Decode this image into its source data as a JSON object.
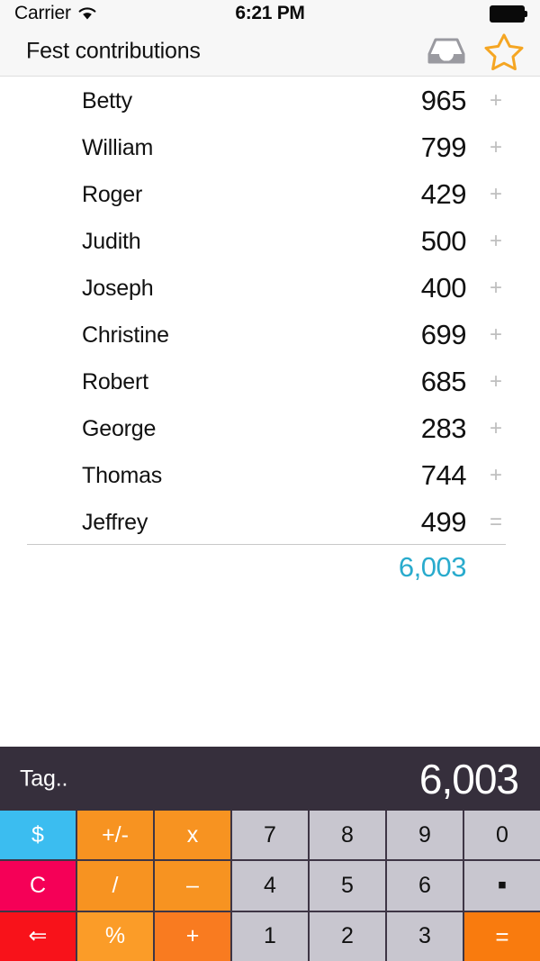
{
  "status_bar": {
    "carrier": "Carrier",
    "wifi_icon": "wifi-icon",
    "time": "6:21 PM",
    "battery_icon": "battery-full-icon"
  },
  "navbar": {
    "title": "Fest contributions",
    "actions": [
      {
        "name": "inbox-icon",
        "label": "Inbox"
      },
      {
        "name": "star-icon",
        "label": "Favorite"
      }
    ]
  },
  "list": {
    "rows": [
      {
        "name": "Betty",
        "value": "965",
        "op": "+"
      },
      {
        "name": "William",
        "value": "799",
        "op": "+"
      },
      {
        "name": "Roger",
        "value": "429",
        "op": "+"
      },
      {
        "name": "Judith",
        "value": "500",
        "op": "+"
      },
      {
        "name": "Joseph",
        "value": "400",
        "op": "+"
      },
      {
        "name": "Christine",
        "value": "699",
        "op": "+"
      },
      {
        "name": "Robert",
        "value": "685",
        "op": "+"
      },
      {
        "name": "George",
        "value": "283",
        "op": "+"
      },
      {
        "name": "Thomas",
        "value": "744",
        "op": "+"
      },
      {
        "name": "Jeffrey",
        "value": "499",
        "op": "="
      }
    ],
    "total": "6,003"
  },
  "calculator": {
    "tag_placeholder": "Tag..",
    "display_value": "6,003",
    "keys": [
      [
        {
          "label": "$",
          "name": "currency-key",
          "style": "act-dollar"
        },
        {
          "label": "+/-",
          "name": "sign-key",
          "style": "op"
        },
        {
          "label": "x",
          "name": "multiply-key",
          "style": "op"
        },
        {
          "label": "7",
          "name": "digit-7-key",
          "style": "num"
        },
        {
          "label": "8",
          "name": "digit-8-key",
          "style": "num"
        },
        {
          "label": "9",
          "name": "digit-9-key",
          "style": "num"
        },
        {
          "label": "0",
          "name": "digit-0-key",
          "style": "num"
        }
      ],
      [
        {
          "label": "C",
          "name": "clear-key",
          "style": "act-clear"
        },
        {
          "label": "/",
          "name": "divide-key",
          "style": "op"
        },
        {
          "label": "–",
          "name": "minus-key",
          "style": "op"
        },
        {
          "label": "4",
          "name": "digit-4-key",
          "style": "num"
        },
        {
          "label": "5",
          "name": "digit-5-key",
          "style": "num"
        },
        {
          "label": "6",
          "name": "digit-6-key",
          "style": "num"
        },
        {
          "label": "▪",
          "name": "decimal-key",
          "style": "num dot"
        }
      ],
      [
        {
          "label": "⇐",
          "name": "backspace-key",
          "style": "act-back"
        },
        {
          "label": "%",
          "name": "percent-key",
          "style": "op-pct"
        },
        {
          "label": "+",
          "name": "plus-key",
          "style": "op-plus"
        },
        {
          "label": "1",
          "name": "digit-1-key",
          "style": "num"
        },
        {
          "label": "2",
          "name": "digit-2-key",
          "style": "num"
        },
        {
          "label": "3",
          "name": "digit-3-key",
          "style": "num"
        },
        {
          "label": "=",
          "name": "equals-key",
          "style": "op-eq eqsym"
        }
      ]
    ]
  },
  "colors": {
    "accent_total": "#29ABCD",
    "calc_panel": "#362F3C",
    "key_number": "#C8C6CF",
    "key_operator": "#F79321",
    "key_currency": "#3BBDF0",
    "key_clear": "#F50057",
    "key_backspace": "#F8121A",
    "key_equals": "#F97B0E"
  }
}
